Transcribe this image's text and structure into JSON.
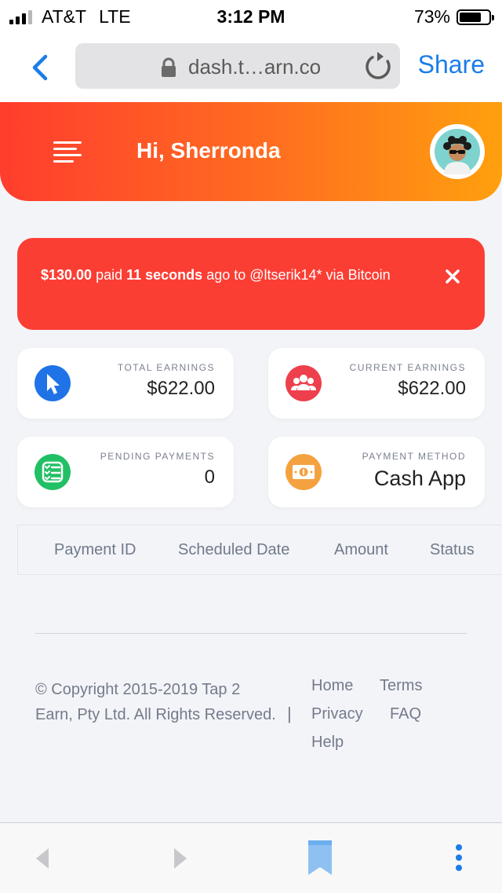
{
  "status_bar": {
    "carrier": "AT&T",
    "network": "LTE",
    "time": "3:12 PM",
    "battery": "73%",
    "battery_level": 0.73
  },
  "browser": {
    "url": "dash.t…arn.co",
    "share_label": "Share",
    "accent": "#1a7de8"
  },
  "header": {
    "greeting": "Hi, Sherronda",
    "gradient": [
      "#ff3d2e",
      "#ffa00e"
    ]
  },
  "alert": {
    "amount": "$130.00",
    "word_paid": " paid ",
    "time_ago": "11 seconds",
    "word_ago_to": " ago to ",
    "recipient": "@ltserik14*",
    "word_via": " via ",
    "method": "Bitcoin",
    "color": "#fb3e34"
  },
  "cards": {
    "total": {
      "label": "TOTAL EARNINGS",
      "value": "$622.00",
      "icon": "cursor-icon",
      "color": "#1f73e6"
    },
    "current": {
      "label": "CURRENT EARNINGS",
      "value": "$622.00",
      "icon": "users-icon",
      "color": "#ee3f4c"
    },
    "pending": {
      "label": "PENDING PAYMENTS",
      "value": "0",
      "icon": "checklist-icon",
      "color": "#22c065"
    },
    "method": {
      "label": "PAYMENT METHOD",
      "value": "Cash App",
      "icon": "cash-icon",
      "color": "#f4a23f"
    }
  },
  "table": {
    "columns": [
      "Payment ID",
      "Scheduled Date",
      "Amount",
      "Status"
    ]
  },
  "footer": {
    "copyright": "© Copyright 2015-2019 Tap 2 Earn, Pty Ltd. All Rights Reserved.",
    "separator": "|",
    "links": [
      "Home",
      "Terms",
      "Privacy",
      "FAQ",
      "Help"
    ]
  }
}
